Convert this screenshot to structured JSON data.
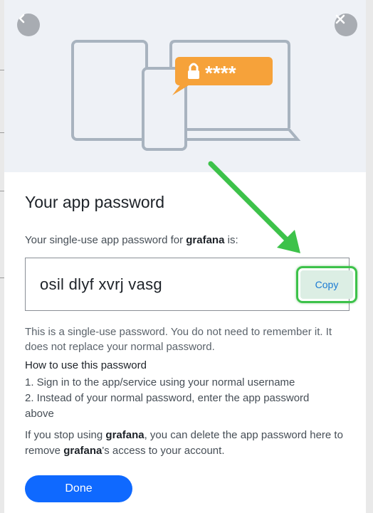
{
  "hero": {
    "lock_badge_text": "****",
    "colors": {
      "badge": "#f6a23a",
      "device_stroke": "#a8b3bf",
      "hero_bg": "#eef1f6"
    }
  },
  "nav": {
    "back_icon": "chevron-left-icon",
    "close_icon": "close-icon"
  },
  "dialog": {
    "title": "Your app password",
    "subtitle_prefix": "Your single-use app password for ",
    "subtitle_app": "grafana",
    "subtitle_suffix": " is:",
    "password": "osil  dlyf  xvrj  vasg",
    "copy_label": "Copy",
    "note": "This is a single-use password. You do not need to remember it. It does not replace your normal password.",
    "howto_title": "How to use this password",
    "step1": "1. Sign in to the app/service using your normal username",
    "step2": "2. Instead of your normal password, enter the app password above",
    "para_prefix": "If you stop using ",
    "para_app1": "grafana",
    "para_middle": ", you can delete the app password here to remove ",
    "para_app2": "grafana",
    "para_suffix": "'s access to your account.",
    "done_label": "Done"
  },
  "colors": {
    "primary": "#0f69ff",
    "highlight": "#3dc24a",
    "link": "#1b7ad3"
  }
}
